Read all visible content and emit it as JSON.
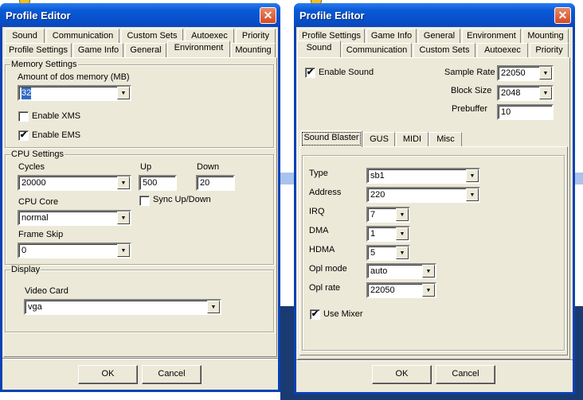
{
  "left_window": {
    "title": "Profile Editor",
    "tabs_row1": [
      "Sound",
      "Communication",
      "Custom Sets",
      "Autoexec",
      "Priority"
    ],
    "tabs_row2": [
      "Profile Settings",
      "Game Info",
      "General",
      "Environment",
      "Mounting"
    ],
    "selected_tab": "Environment",
    "memory": {
      "group": "Memory Settings",
      "amount_label": "Amount of dos memory (MB)",
      "amount_value": "32",
      "xms_label": "Enable XMS",
      "xms_checked": false,
      "ems_label": "Enable EMS",
      "ems_checked": true
    },
    "cpu": {
      "group": "CPU Settings",
      "cycles_label": "Cycles",
      "cycles_value": "20000",
      "up_label": "Up",
      "up_value": "500",
      "down_label": "Down",
      "down_value": "20",
      "sync_label": "Sync Up/Down",
      "sync_checked": false,
      "core_label": "CPU Core",
      "core_value": "normal",
      "frameskip_label": "Frame Skip",
      "frameskip_value": "0"
    },
    "display": {
      "group": "Display",
      "videocard_label": "Video Card",
      "videocard_value": "vga"
    },
    "ok": "OK",
    "cancel": "Cancel"
  },
  "right_window": {
    "title": "Profile Editor",
    "tabs_row1": [
      "Profile Settings",
      "Game Info",
      "General",
      "Environment",
      "Mounting"
    ],
    "tabs_row2": [
      "Sound",
      "Communication",
      "Custom Sets",
      "Autoexec",
      "Priority"
    ],
    "selected_tab": "Sound",
    "enable_sound_label": "Enable Sound",
    "enable_sound_checked": true,
    "sample_rate_label": "Sample Rate",
    "sample_rate_value": "22050",
    "block_size_label": "Block Size",
    "block_size_value": "2048",
    "prebuffer_label": "Prebuffer",
    "prebuffer_value": "10",
    "inner_tabs": [
      "Sound Blaster",
      "GUS",
      "MIDI",
      "Misc"
    ],
    "selected_inner_tab": "Sound Blaster",
    "sb": {
      "type_label": "Type",
      "type_value": "sb1",
      "address_label": "Address",
      "address_value": "220",
      "irq_label": "IRQ",
      "irq_value": "7",
      "dma_label": "DMA",
      "dma_value": "1",
      "hdma_label": "HDMA",
      "hdma_value": "5",
      "oplmode_label": "Opl mode",
      "oplmode_value": "auto",
      "oplrate_label": "Opl rate",
      "oplrate_value": "22050",
      "mixer_label": "Use Mixer",
      "mixer_checked": true
    },
    "ok": "OK",
    "cancel": "Cancel"
  },
  "icons": {
    "close": "✕",
    "dropdown": "▼",
    "check": "✔"
  }
}
